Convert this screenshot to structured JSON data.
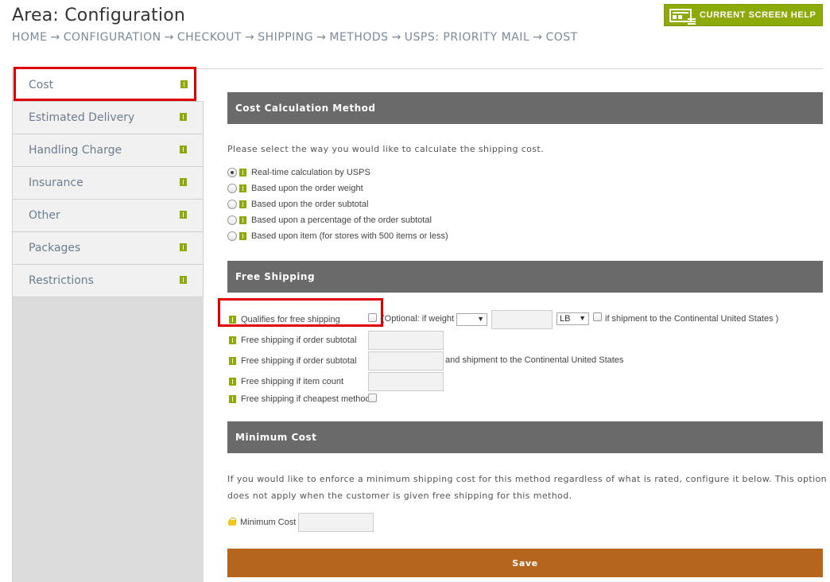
{
  "header": {
    "title": "Area: Configuration",
    "breadcrumb": [
      "HOME",
      "CONFIGURATION",
      "CHECKOUT",
      "SHIPPING",
      "METHODS",
      "USPS: PRIORITY MAIL",
      "COST"
    ],
    "separator": "→",
    "help_label": "CURRENT SCREEN HELP"
  },
  "sidebar": {
    "items": [
      {
        "label": "Cost",
        "active": true
      },
      {
        "label": "Estimated Delivery"
      },
      {
        "label": "Handling Charge"
      },
      {
        "label": "Insurance"
      },
      {
        "label": "Other"
      },
      {
        "label": "Packages"
      },
      {
        "label": "Restrictions"
      }
    ]
  },
  "cost_method": {
    "header": "Cost Calculation Method",
    "instruction": "Please select the way you would like to calculate the shipping cost.",
    "options": [
      "Real-time calculation by USPS",
      "Based upon the order weight",
      "Based upon the order subtotal",
      "Based upon a percentage of the order subtotal",
      "Based upon item (for stores with 500 items or less)"
    ],
    "selected_index": 0
  },
  "free_shipping": {
    "header": "Free Shipping",
    "qualifies_label": "Qualifies for free shipping",
    "optional_prefix": "(Optional: if weight",
    "weight_operator": "",
    "weight_value": "",
    "weight_unit": "LB",
    "continental_suffix": "if shipment to the Continental United States )",
    "subtotal_label": "Free shipping if order subtotal",
    "subtotal_value": "",
    "subtotal_continental_label": "Free shipping if order subtotal",
    "subtotal_continental_value": "",
    "subtotal_continental_suffix": "and shipment to the Continental United States",
    "item_count_label": "Free shipping if item count",
    "item_count_value": "",
    "cheapest_label": "Free shipping if cheapest method"
  },
  "minimum_cost": {
    "header": "Minimum Cost",
    "description_line1": "If you would like to enforce a minimum shipping cost for this method regardless of what is rated, configure it below. This option",
    "description_line2": "does not apply when the customer is given free shipping for this method.",
    "label": "Minimum Cost",
    "value": ""
  },
  "save_label": "Save"
}
